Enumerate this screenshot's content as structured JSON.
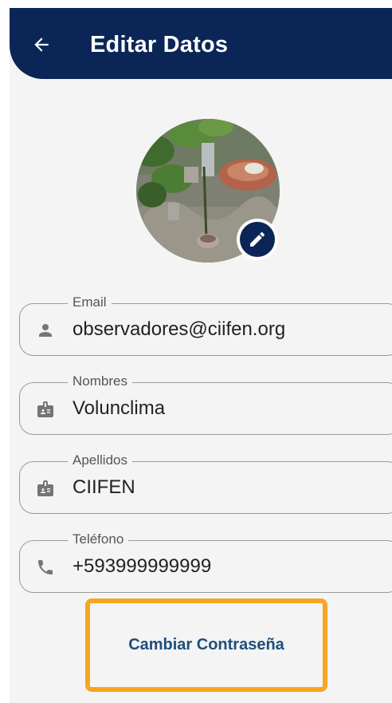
{
  "appbar": {
    "title": "Editar Datos",
    "back_icon": "arrow-left-icon"
  },
  "profile": {
    "photo": "profile-photo-plants",
    "edit_icon": "pencil-icon"
  },
  "fields": [
    {
      "label": "Email",
      "value": "observadores@ciifen.org",
      "icon": "person-icon"
    },
    {
      "label": "Nombres",
      "value": "Volunclima",
      "icon": "id-badge-icon"
    },
    {
      "label": "Apellidos",
      "value": "CIIFEN",
      "icon": "id-badge-icon"
    },
    {
      "label": "Teléfono",
      "value": "+593999999999",
      "icon": "phone-icon"
    }
  ],
  "change_password": {
    "label": "Cambiar Contraseña"
  },
  "colors": {
    "appbar": "#0b2656",
    "link": "#1e4e7c",
    "highlight": "#f5a623",
    "background": "#f4f4f4"
  }
}
